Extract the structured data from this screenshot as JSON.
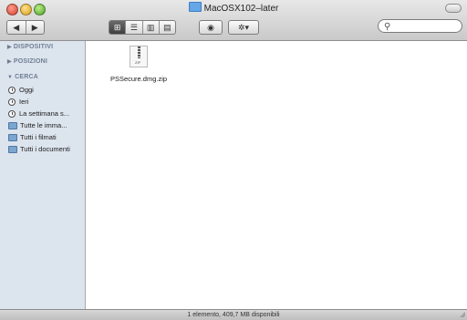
{
  "window": {
    "title": "MacOSX102–later"
  },
  "toolbar": {
    "back_glyph": "◀",
    "forward_glyph": "▶",
    "view_icon_glyph": "⊞",
    "view_list_glyph": "☰",
    "view_column_glyph": "▥",
    "view_coverflow_glyph": "▤",
    "quicklook_glyph": "◉",
    "action_glyph": "✲▾",
    "search_glyph": "⚲",
    "search_placeholder": ""
  },
  "sidebar": {
    "sections": [
      {
        "label": "DISPOSITIVI",
        "collapsed": true
      },
      {
        "label": "POSIZIONI",
        "collapsed": true
      },
      {
        "label": "CERCA",
        "collapsed": false
      }
    ],
    "search_items": [
      {
        "label": "Oggi",
        "icon": "clock-icon"
      },
      {
        "label": "Ieri",
        "icon": "clock-icon"
      },
      {
        "label": "La settimana s...",
        "icon": "clock-icon"
      },
      {
        "label": "Tutte le imma...",
        "icon": "smart-folder-icon"
      },
      {
        "label": "Tutti i filmati",
        "icon": "smart-folder-icon"
      },
      {
        "label": "Tutti i documenti",
        "icon": "smart-folder-icon"
      }
    ]
  },
  "content": {
    "files": [
      {
        "name": "PSSecure.dmg.zip",
        "icon": "zip-file-icon",
        "tag": "ZIP"
      }
    ]
  },
  "status": {
    "text": "1 elemento, 409,7 MB disponibili"
  }
}
